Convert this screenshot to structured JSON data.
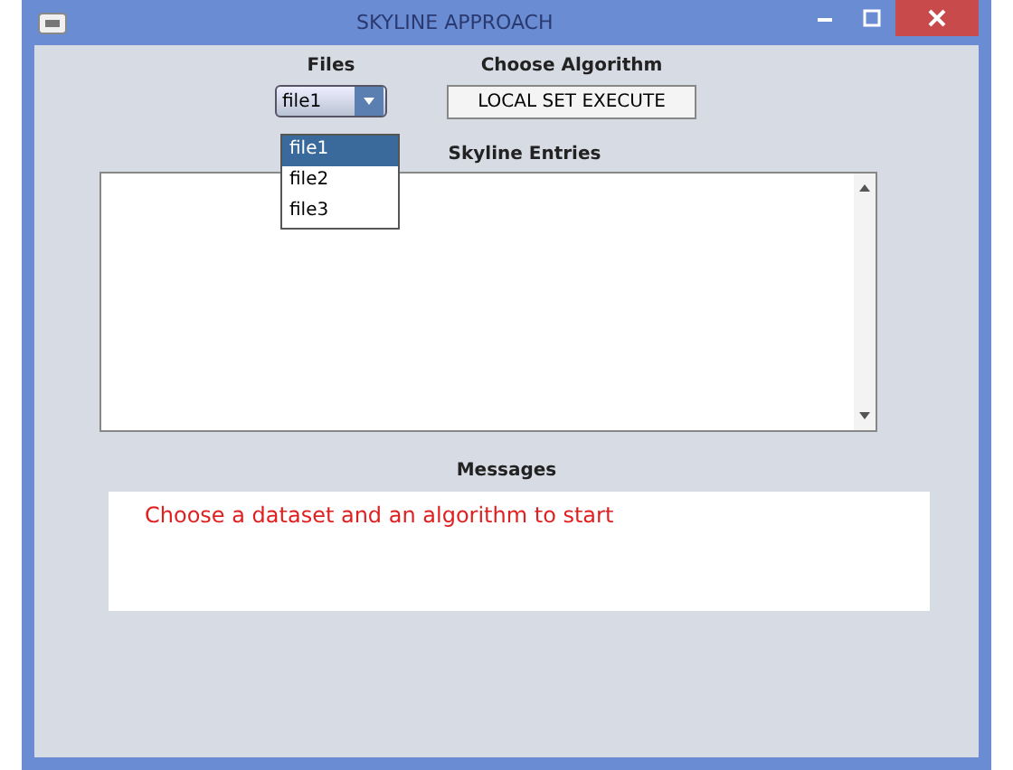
{
  "window": {
    "title": "SKYLINE APPROACH"
  },
  "files": {
    "label": "Files",
    "value": "file1",
    "options": [
      {
        "label": "file1",
        "selected": true
      },
      {
        "label": "file2",
        "selected": false
      },
      {
        "label": "file3",
        "selected": false
      }
    ]
  },
  "algorithm": {
    "label": "Choose Algorithm",
    "button": "LOCAL SET EXECUTE"
  },
  "skyline": {
    "label": "Skyline Entries"
  },
  "messages": {
    "label": "Messages",
    "text": "Choose a dataset and an algorithm to start"
  }
}
